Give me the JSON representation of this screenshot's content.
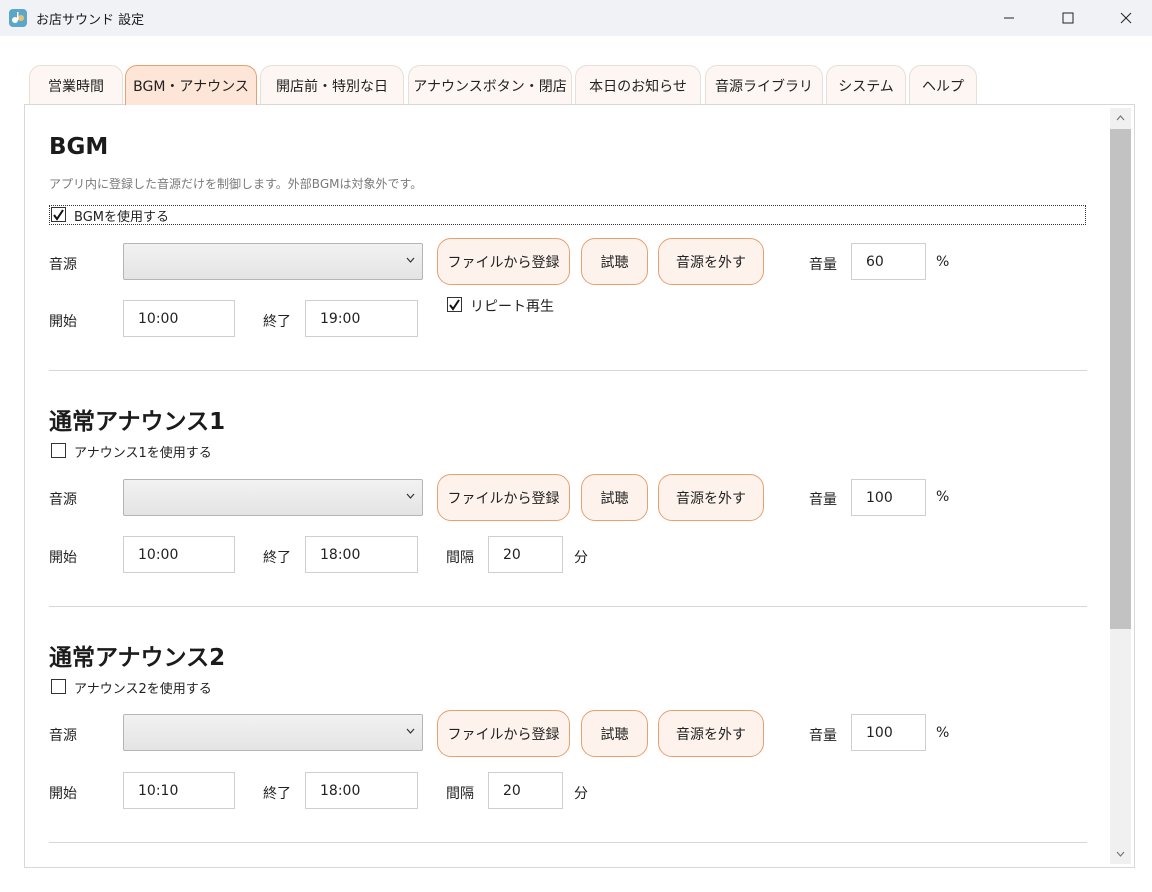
{
  "window": {
    "title": "お店サウンド 設定",
    "controls": {
      "minimize": "minimize",
      "maximize": "maximize",
      "close": "close"
    }
  },
  "tabs": [
    {
      "label": "営業時間",
      "active": false
    },
    {
      "label": "BGM・アナウンス",
      "active": true
    },
    {
      "label": "開店前・特別な日",
      "active": false
    },
    {
      "label": "アナウンスボタン・閉店",
      "active": false
    },
    {
      "label": "本日のお知らせ",
      "active": false
    },
    {
      "label": "音源ライブラリ",
      "active": false
    },
    {
      "label": "システム",
      "active": false
    },
    {
      "label": "ヘルプ",
      "active": false
    }
  ],
  "bgm": {
    "title": "BGM",
    "description": "アプリ内に登録した音源だけを制御します。外部BGMは対象外です。",
    "enable_label": "BGMを使用する",
    "enabled": true,
    "source_label": "音源",
    "source_value": "",
    "register_button": "ファイルから登録",
    "preview_button": "試聴",
    "remove_button": "音源を外す",
    "volume_label": "音量",
    "volume": "60",
    "volume_unit": "%",
    "start_label": "開始",
    "start": "10:00",
    "end_label": "終了",
    "end": "19:00",
    "repeat_label": "リピート再生",
    "repeat": true
  },
  "announce1": {
    "title": "通常アナウンス1",
    "enable_label": "アナウンス1を使用する",
    "enabled": false,
    "source_label": "音源",
    "source_value": "",
    "register_button": "ファイルから登録",
    "preview_button": "試聴",
    "remove_button": "音源を外す",
    "volume_label": "音量",
    "volume": "100",
    "volume_unit": "%",
    "start_label": "開始",
    "start": "10:00",
    "end_label": "終了",
    "end": "18:00",
    "interval_label": "間隔",
    "interval": "20",
    "interval_unit": "分"
  },
  "announce2": {
    "title": "通常アナウンス2",
    "enable_label": "アナウンス2を使用する",
    "enabled": false,
    "source_label": "音源",
    "source_value": "",
    "register_button": "ファイルから登録",
    "preview_button": "試聴",
    "remove_button": "音源を外す",
    "volume_label": "音量",
    "volume": "100",
    "volume_unit": "%",
    "start_label": "開始",
    "start": "10:10",
    "end_label": "終了",
    "end": "18:00",
    "interval_label": "間隔",
    "interval": "20",
    "interval_unit": "分"
  },
  "colors": {
    "accent_border": "#e8a070",
    "button_bg": "#fdf3ec",
    "active_tab_bg": "#fde6d8"
  }
}
